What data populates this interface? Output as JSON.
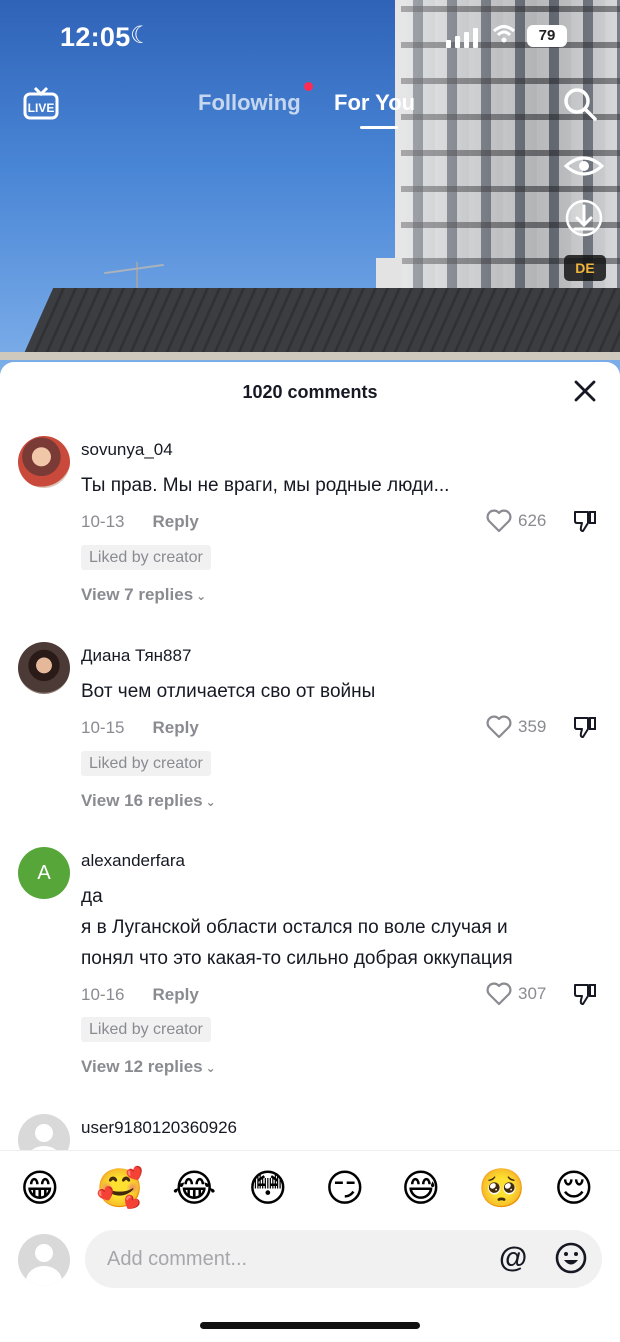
{
  "status_bar": {
    "time": "12:05",
    "battery": "79"
  },
  "top_nav": {
    "following": "Following",
    "for_you": "For You",
    "badge": "DE"
  },
  "comments_sheet": {
    "title": "1020 comments",
    "comments": [
      {
        "username": "sovunya_04",
        "text": "Ты прав. Мы не враги, мы родные люди...",
        "date": "10-13",
        "reply": "Reply",
        "likes": "626",
        "liked_by_creator": "Liked by creator",
        "view_replies": "View 7 replies"
      },
      {
        "username": "Диана Тян887",
        "text": "Вот чем отличается сво от войны",
        "date": "10-15",
        "reply": "Reply",
        "likes": "359",
        "liked_by_creator": "Liked by creator",
        "view_replies": "View 16 replies"
      },
      {
        "username": "alexanderfara",
        "avatar_letter": "A",
        "text_lines": [
          "да",
          "я в Луганской области остался по воле случая и",
          "понял что это какая-то сильно добрая оккупация"
        ],
        "date": "10-16",
        "reply": "Reply",
        "likes": "307",
        "liked_by_creator": "Liked by creator",
        "view_replies": "View 12 replies"
      },
      {
        "username": "user9180120360926"
      }
    ]
  },
  "emoji_bar": [
    "😁",
    "🥰",
    "😂",
    "😳",
    "😏",
    "😅",
    "🥺",
    "😌"
  ],
  "input": {
    "placeholder": "Add comment...",
    "mention": "@"
  }
}
